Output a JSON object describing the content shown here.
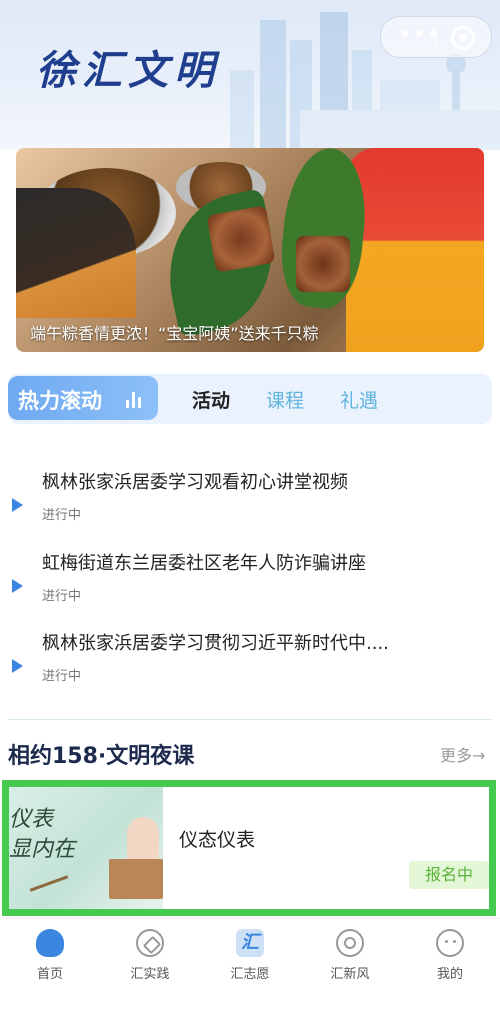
{
  "header": {
    "app_title": "徐汇文明",
    "capsule": {
      "more_icon": "more-dots-icon",
      "close_icon": "target-close-icon"
    }
  },
  "banner": {
    "caption": "端午粽香情更浓！“宝宝阿姨”送来千只粽"
  },
  "tabs": {
    "active_label": "热力滚动",
    "items": [
      {
        "label": "活动"
      },
      {
        "label": "课程"
      },
      {
        "label": "礼遇"
      }
    ]
  },
  "activities": [
    {
      "title": "枫林张家浜居委学习观看初心讲堂视频",
      "status": "进行中"
    },
    {
      "title": "虹梅街道东兰居委社区老年人防诈骗讲座",
      "status": "进行中"
    },
    {
      "title": "枫林张家浜居委学习贯彻习近平新时代中....",
      "status": "进行中"
    }
  ],
  "night_class": {
    "section_title": "相约158·文明夜课",
    "more_label": "更多→",
    "course": {
      "thumb_text": "仪表\n显内在",
      "name": "仪态仪表",
      "badge": "报名中"
    }
  },
  "navbar": {
    "items": [
      {
        "label": "首页",
        "icon": "heart-icon"
      },
      {
        "label": "汇实践",
        "icon": "compass-icon"
      },
      {
        "label": "汇志愿",
        "icon": "hui-icon"
      },
      {
        "label": "汇新风",
        "icon": "swirl-icon"
      },
      {
        "label": "我的",
        "icon": "profile-icon"
      }
    ]
  }
}
